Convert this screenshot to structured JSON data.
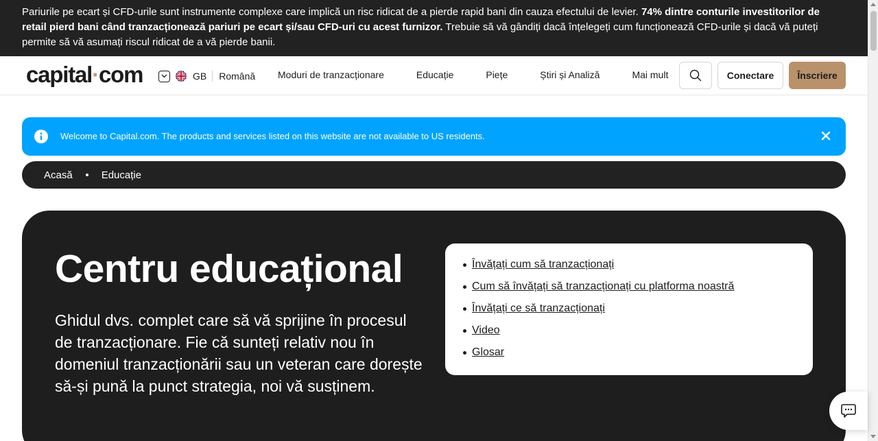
{
  "risk_warning": {
    "text_start": "Pariurile pe ecart și CFD-urile sunt instrumente complexe care implică un risc ridicat de a pierde rapid bani din cauza efectului de levier. ",
    "text_bold": "74% dintre conturile investitorilor de retail pierd bani când tranzacționează pariuri pe ecart și/sau CFD-uri cu acest furnizor.",
    "text_end": " Trebuie să vă gândiți dacă înțelegeți cum funcționează CFD-urile și dacă vă puteți permite să vă asumați riscul ridicat de a vă pierde banii."
  },
  "header": {
    "logo_left": "capital",
    "logo_dot": "·",
    "logo_right": "com",
    "region": "GB",
    "language": "Română",
    "nav": [
      "Moduri de tranzacționare",
      "Educație",
      "Piețe",
      "Știri și Analiză",
      "Mai mult"
    ],
    "login_label": "Conectare",
    "signup_label": "Înscriere",
    "accent_color": "#b9916a"
  },
  "notice": {
    "text": "Welcome to Capital.com. The products and services listed on this website are not available to US residents.",
    "color": "#00a3ff"
  },
  "breadcrumb": [
    "Acasă",
    "Educație"
  ],
  "hero": {
    "title": "Centru educațional",
    "description": "Ghidul dvs. complet care să vă sprijine în procesul de tranzacționare. Fie că sunteți relativ nou în domeniul tranzacționării sau un veteran care dorește să-și pună la punct strategia, noi vă susținem.",
    "links": [
      "Învățați cum să tranzacționați",
      "Cum să învățați să tranzacționați cu platforma noastră",
      "Învățați ce să tranzacționați",
      "Video",
      "Glosar"
    ]
  }
}
